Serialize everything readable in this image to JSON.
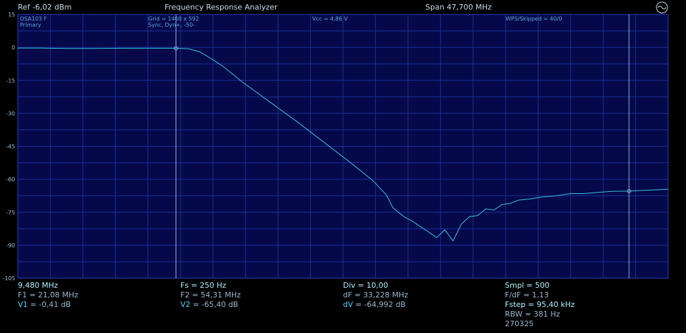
{
  "topbar": {
    "ref": "Ref  -6,02 dBm",
    "title": "Frequency Response Analyzer",
    "span": "Span 47,700 MHz"
  },
  "overlay": {
    "device": "OSA103 F",
    "channel": "Primary",
    "grid": "Grid = 1460 x 592",
    "sync": "Sync,  Dyn+,  -50-",
    "vcc": "Vcc = 4,86 V",
    "wps": "WPS/Skipped  = 40/0"
  },
  "y_axis": {
    "ticks": [
      15,
      0,
      -15,
      -30,
      -45,
      -60,
      -75,
      -90,
      -105
    ],
    "labels": [
      "15",
      "0",
      "-15",
      "-30",
      "-45",
      "-60",
      "-75",
      "-90",
      "-105"
    ]
  },
  "chart_data": {
    "type": "line",
    "ylim": [
      -105,
      15
    ],
    "xlim": [
      9.48,
      57.18
    ],
    "x_unit": "MHz",
    "y_unit": "dB",
    "grid": true,
    "series": [
      {
        "x": [
          9.48,
          11.0,
          13.0,
          15.0,
          17.0,
          19.0,
          21.08,
          22.0,
          22.8,
          23.5,
          24.5,
          26.0,
          28.0,
          30.0,
          32.0,
          34.0,
          35.5,
          36.5,
          37.0,
          37.8,
          38.4,
          39.0,
          39.6,
          40.2,
          40.8,
          41.4,
          42.0,
          42.6,
          43.2,
          43.8,
          44.4,
          45.0,
          45.6,
          46.2,
          47.0,
          48.0,
          49.0,
          50.0,
          51.0,
          52.0,
          53.0,
          54.31,
          55.5,
          57.18
        ],
        "y": [
          -0.3,
          -0.3,
          -0.5,
          -0.5,
          -0.4,
          -0.4,
          -0.41,
          -0.6,
          -2.0,
          -4.5,
          -8.5,
          -16.0,
          -25.0,
          -34.0,
          -43.5,
          -53.0,
          -60.5,
          -67.0,
          -73.0,
          -77.0,
          -79.0,
          -81.5,
          -84.0,
          -86.5,
          -83.0,
          -88.0,
          -80.5,
          -77.0,
          -76.5,
          -73.5,
          -74.0,
          -71.5,
          -71.0,
          -69.5,
          -69.0,
          -68.0,
          -67.5,
          -66.5,
          -66.5,
          -66.0,
          -65.5,
          -65.4,
          -65.0,
          -64.5
        ]
      }
    ],
    "markers": [
      {
        "x": 21.08,
        "y": -0.41
      },
      {
        "x": 54.31,
        "y": -65.4
      }
    ]
  },
  "colors": {
    "plot_bg": "#05094a",
    "grid": "#1c2f9a",
    "trace": "#33c8dc",
    "marker_line": "#8fb4cc"
  },
  "info": {
    "col1": {
      "start": "9,480 MHz",
      "f1": "F1 = 21,08 MHz",
      "v1_label": "V1",
      "v1_value": " = -0,41 dB"
    },
    "col2": {
      "fs": "Fs = 250 Hz",
      "f2": "F2 = 54,31 MHz",
      "v2_label": "V2",
      "v2_value": " = -65,40 dB"
    },
    "col3": {
      "div": "Div = 10,00",
      "df": "dF = 33,228 MHz",
      "dv_label": "dV",
      "dv_value": " = -64,992 dB"
    },
    "col4": {
      "smpl": "Smpl = 500",
      "fdf": "F/dF = 1,13",
      "fstep": "Fstep = 95,40 kHz",
      "rbw": "RBW = 381 Hz",
      "id": "270325"
    }
  }
}
